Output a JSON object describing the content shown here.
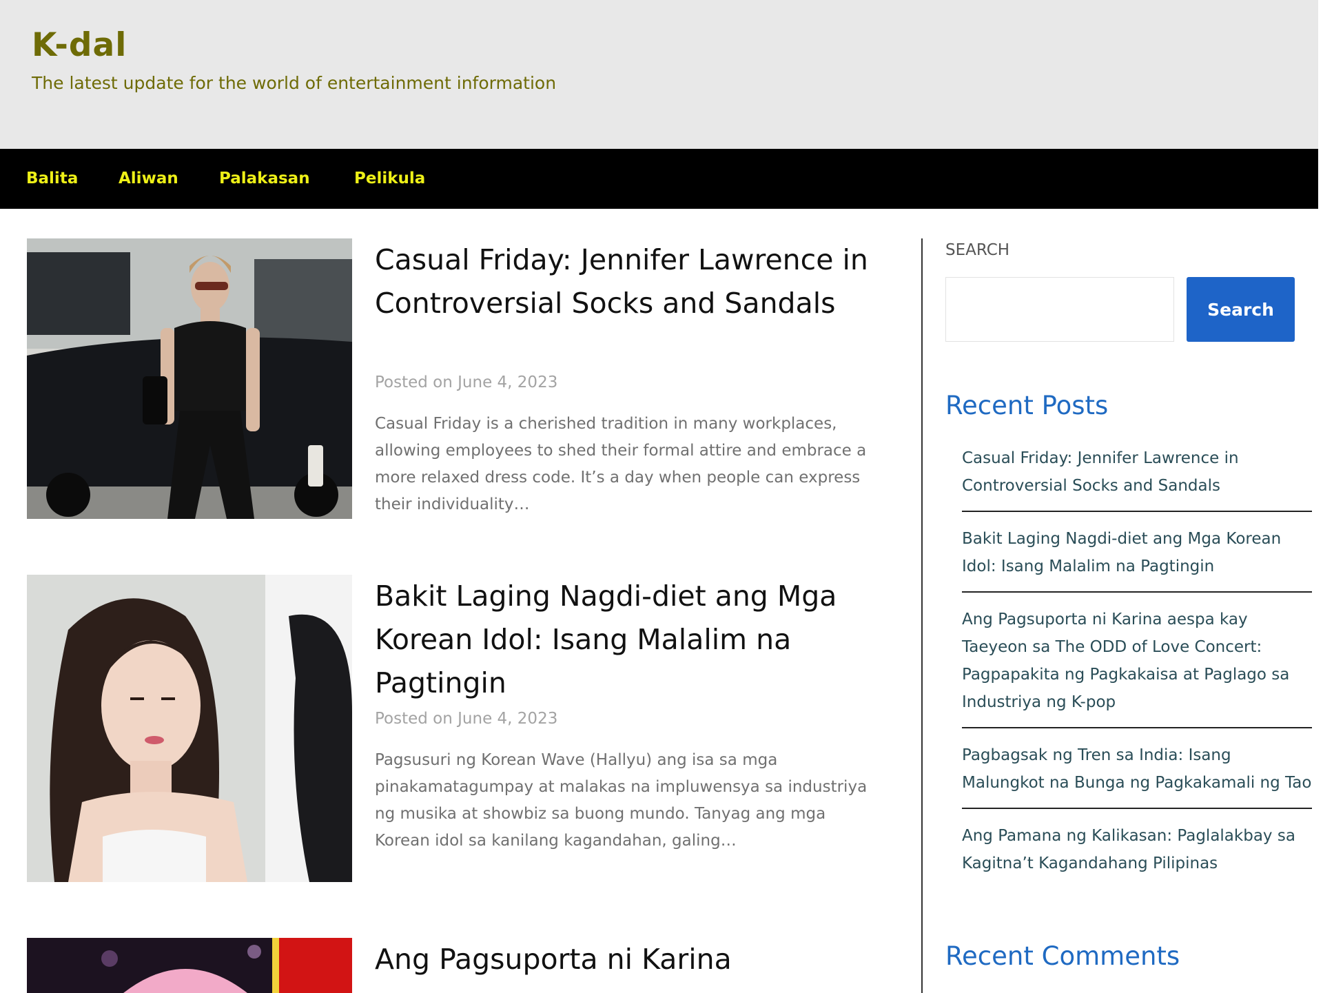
{
  "site": {
    "title": "K-dal",
    "tagline": "The latest update for the world of entertainment information"
  },
  "nav": {
    "items": [
      "Balita",
      "Aliwan",
      "Palakasan",
      "Pelikula"
    ]
  },
  "articles": [
    {
      "title": "Casual Friday: Jennifer Lawrence in Controversial Socks and Sandals",
      "date": "Posted on June 4, 2023",
      "excerpt": "Casual Friday is a cherished tradition in many workplaces, allowing employees to shed their formal attire and embrace a more relaxed dress code. It’s a day when people can express their individuality…"
    },
    {
      "title": "Bakit Laging Nagdi-diet ang Mga Korean Idol: Isang Malalim na Pagtingin",
      "date": "Posted on June 4, 2023",
      "excerpt": "Pagsusuri ng Korean Wave (Hallyu) ang isa sa mga pinakamatagumpay at malakas na impluwensya sa industriya ng musika at showbiz sa buong mundo. Tanyag ang mga Korean idol sa kanilang kagandahan, galing…"
    },
    {
      "title": "Ang Pagsuporta ni Karina"
    }
  ],
  "sidebar": {
    "search_label": "SEARCH",
    "search_button": "Search",
    "recent_posts_title": "Recent Posts",
    "recent_posts": [
      "Casual Friday: Jennifer Lawrence in Controversial Socks and Sandals",
      "Bakit Laging Nagdi-diet ang Mga Korean Idol: Isang Malalim na Pagtingin",
      "Ang Pagsuporta ni Karina aespa kay Taeyeon sa The ODD of Love Concert: Pagpapakita ng Pagkakaisa at Paglago sa Industriya ng K-pop",
      "Pagbagsak ng Tren sa India: Isang Malungkot na Bunga ng Pagkakamali ng Tao",
      "Ang Pamana ng Kalikasan: Paglalakbay sa Kagitna’t Kagandahang Pilipinas"
    ],
    "recent_comments_title": "Recent Comments"
  },
  "colors": {
    "header_bg": "#e8e8e8",
    "brand": "#6e6b06",
    "nav_bg": "#000000",
    "nav_text": "#eef017",
    "accent_blue": "#1e64c8",
    "widget_title": "#1f6ac2"
  }
}
